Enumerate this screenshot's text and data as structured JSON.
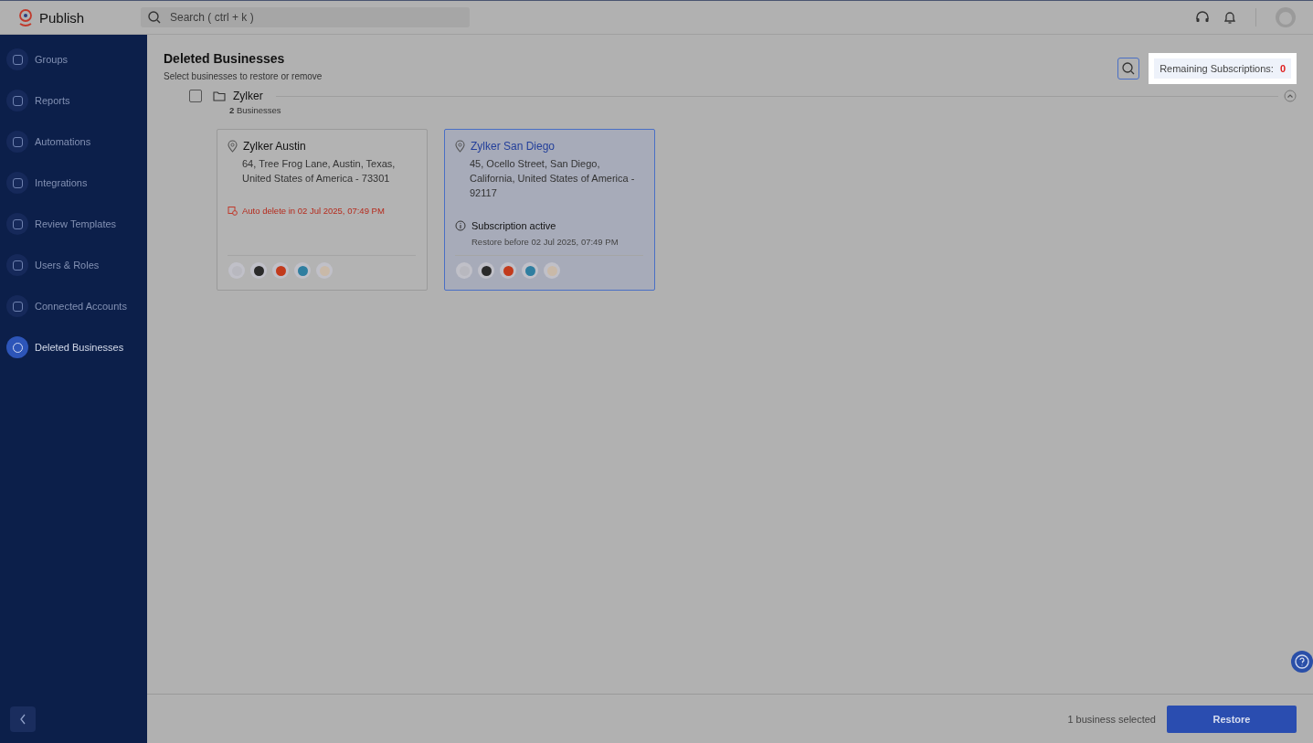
{
  "app": {
    "title": "Publish"
  },
  "search": {
    "placeholder": "Search ( ctrl + k )"
  },
  "sidebar": {
    "items": [
      {
        "label": "Groups",
        "selected": false
      },
      {
        "label": "Reports",
        "selected": false
      },
      {
        "label": "Automations",
        "selected": false
      },
      {
        "label": "Integrations",
        "selected": false
      },
      {
        "label": "Review Templates",
        "selected": false
      },
      {
        "label": "Users & Roles",
        "selected": false
      },
      {
        "label": "Connected Accounts",
        "selected": false
      },
      {
        "label": "Deleted Businesses",
        "selected": true
      }
    ]
  },
  "page": {
    "title": "Deleted Businesses",
    "subtitle": "Select businesses to restore or remove"
  },
  "subscriptions": {
    "label": "Remaining Subscriptions:",
    "count": "0"
  },
  "group": {
    "name": "Zylker",
    "count": "2",
    "count_label": "Businesses",
    "checked": false,
    "expanded": true,
    "businesses": [
      {
        "name": "Zylker Austin",
        "address": "64, Tree Frog Lane, Austin, Texas, United States of America - 73301",
        "selected": false,
        "kind": "auto_delete",
        "status": "Auto delete in 02 Jul 2025, 07:49 PM"
      },
      {
        "name": "Zylker San Diego",
        "address": "45, Ocello Street, San Diego, California, United States of America - 92117",
        "selected": true,
        "kind": "subscription",
        "status": "Subscription active",
        "note": "Restore before 02 Jul 2025, 07:49 PM"
      }
    ]
  },
  "footer": {
    "selection": "1 business selected",
    "button": "Restore"
  }
}
